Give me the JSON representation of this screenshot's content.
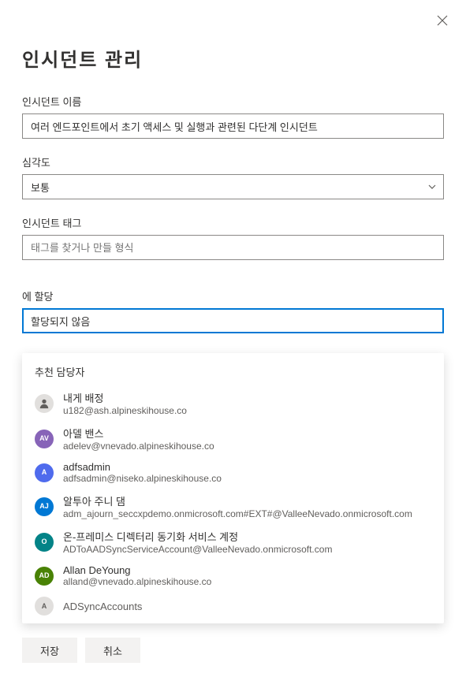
{
  "title": "인시던트 관리",
  "fields": {
    "name": {
      "label": "인시던트 이름",
      "value": "여러 엔드포인트에서 초기 액세스 및 실행과 관련된 다단계 인시던트"
    },
    "severity": {
      "label": "심각도",
      "value": "보통"
    },
    "tags": {
      "label": "인시던트 태그",
      "placeholder": "태그를 찾거나 만들 형식"
    },
    "assign": {
      "label": "에 할당",
      "value": "할당되지 않음"
    }
  },
  "dropdown": {
    "header": "추천 담당자",
    "items": [
      {
        "name": "내게 배정",
        "email": "u182@ash.alpineskihouse.co",
        "avatar": {
          "type": "me"
        }
      },
      {
        "name": "아델 밴스",
        "email": "adelev@vnevado.alpineskihouse.co",
        "avatar": {
          "initials": "AV",
          "color": "#8764b8"
        }
      },
      {
        "name": "adfsadmin",
        "email": "adfsadmin@niseko.alpineskihouse.co",
        "avatar": {
          "initials": "A",
          "color": "#4f6bed"
        }
      },
      {
        "name": "알투아 주니 댐",
        "email": "adm_ajourn_seccxpdemo.onmicrosoft.com#EXT#@ValleeNevado.onmicrosoft.com",
        "avatar": {
          "initials": "AJ",
          "color": "#0078d4"
        }
      },
      {
        "name": "온-프레미스 디렉터리 동기화 서비스 계정",
        "email": "ADToAADSyncServiceAccount@ValleeNevado.onmicrosoft.com",
        "avatar": {
          "initials": "O",
          "color": "#038387"
        }
      },
      {
        "name": "Allan DeYoung",
        "email": "alland@vnevado.alpineskihouse.co",
        "avatar": {
          "initials": "AD",
          "color": "#498205"
        }
      },
      {
        "name": "ADSyncAccounts",
        "email": "",
        "avatar": {
          "initials": "A",
          "color": "#e1dfdd"
        },
        "partial": true
      }
    ]
  },
  "footer": {
    "save": "저장",
    "cancel": "취소"
  }
}
